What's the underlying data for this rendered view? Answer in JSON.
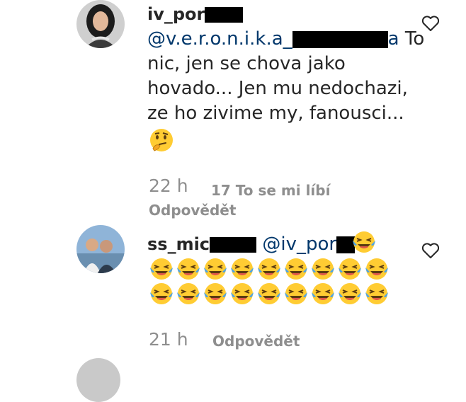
{
  "comments": [
    {
      "username_visible": "iv_por",
      "mention_visible": "@v.e.r.o.n.i.k.a_",
      "mention_tail": "a",
      "text_line1_rest": "To",
      "text_lines": [
        "nic, jen se chova jako",
        "hovado... Jen mu nedochazi,",
        "ze ho zivime my, fanousci..."
      ],
      "emoji": [
        "thinking-face"
      ],
      "time": "22 h",
      "likes": "17 To se mi líbí",
      "reply": "Odpovědět"
    },
    {
      "username_visible": "ss_mic",
      "mention_visible": "@iv_por",
      "mention_tail": "r",
      "emoji_inline": [
        "laughing-tears"
      ],
      "emoji_rows": [
        [
          "laughing-tears",
          "laughing-tears",
          "laughing-tears",
          "laughing-tears",
          "laughing-tears",
          "laughing-tears",
          "laughing-tears",
          "laughing-tears",
          "laughing-tears"
        ],
        [
          "laughing-tears",
          "laughing-tears",
          "laughing-tears",
          "laughing-tears",
          "laughing-tears",
          "laughing-tears",
          "laughing-tears",
          "laughing-tears",
          "laughing-tears"
        ]
      ],
      "time": "21 h",
      "reply": "Odpovědět"
    }
  ],
  "colors": {
    "text": "#262626",
    "mention": "#00376b",
    "muted": "#8e8e8e",
    "emoji": "#ffcc33"
  }
}
